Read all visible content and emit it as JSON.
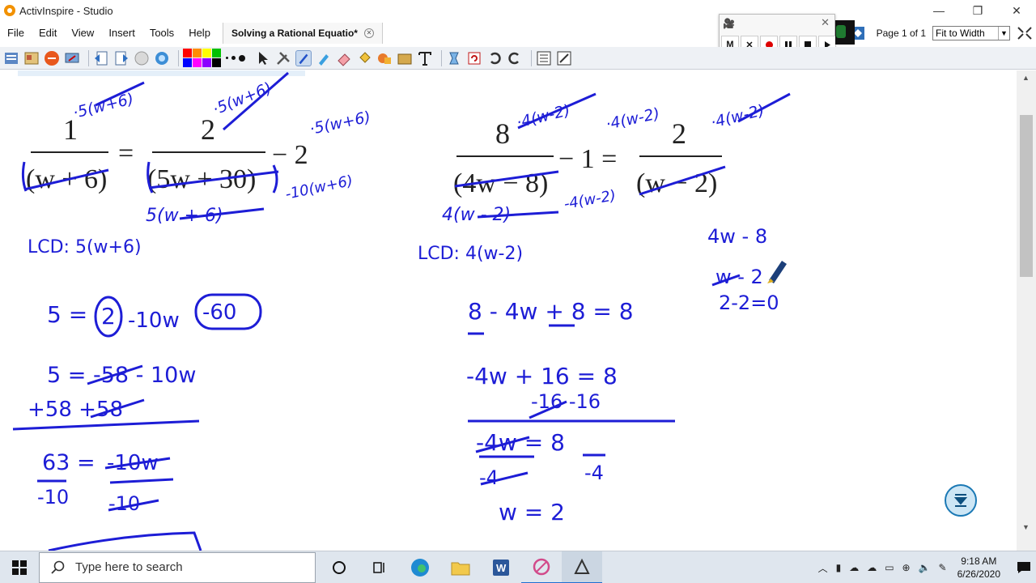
{
  "window": {
    "title": "ActivInspire - Studio"
  },
  "menu": {
    "items": [
      "File",
      "Edit",
      "View",
      "Insert",
      "Tools",
      "Help"
    ],
    "doc_tab": "Solving a Rational Equatio*"
  },
  "page_nav": {
    "label": "Page 1 of 1",
    "zoom": "Fit to Width"
  },
  "recorder": {
    "m_label": "M",
    "x_label": "✕"
  },
  "toolbar": {
    "palette": [
      "#ff0000",
      "#ff8c00",
      "#ffff00",
      "#00c000",
      "#0000ff",
      "#ff00ff",
      "#8b00ff",
      "#000000"
    ]
  },
  "board": {
    "left": {
      "eq_num1": "1",
      "eq_den1": "(w + 6)",
      "eq_equals": "=",
      "eq_num2": "2",
      "eq_den2": "(5w + 30)",
      "eq_minus2": "− 2",
      "ann_num1": "·5(w+6)",
      "ann_num2": "·5(w+6)",
      "ann_two": "·5(w+6)",
      "ann_two_below": "-10(w+6)",
      "ann_den2": "5(w + 6)",
      "lcd": "LCD: 5(w+6)",
      "step1_a": "5 = ",
      "step1_b": "2",
      "step1_c": "-10w",
      "step1_d": "-60",
      "step2": "5 = -58 - 10w",
      "step3": "+58    +58",
      "step4_l": "63 =",
      "step4_r": "-10w",
      "step5_l": "-10",
      "step5_r": "-10"
    },
    "right": {
      "eq_num1": "8",
      "eq_den1": "(4w − 8)",
      "eq_minus1": "− 1 =",
      "eq_num2": "2",
      "eq_den2": "(w − 2)",
      "ann_num1": "·4(w-2)",
      "ann_one": "·4(w-2)",
      "ann_num2": "·4(w-2)",
      "ann_den1": "4(w - 2)",
      "ann_one_below": "-4(w-2)",
      "lcd": "LCD: 4(w-2)",
      "step1": "8 - 4w + 8 = 8",
      "step2": "-4w + 16 = 8",
      "step3": "-16   -16",
      "step4": "-4w = 8",
      "step5_l": "-4",
      "step5_r": "-4",
      "answer": "w = 2",
      "side1": "4w - 8",
      "side2": "w - 2",
      "side3": "2-2=0"
    }
  },
  "taskbar": {
    "search_placeholder": "Type here to search",
    "time": "9:18 AM",
    "date": "6/26/2020"
  }
}
